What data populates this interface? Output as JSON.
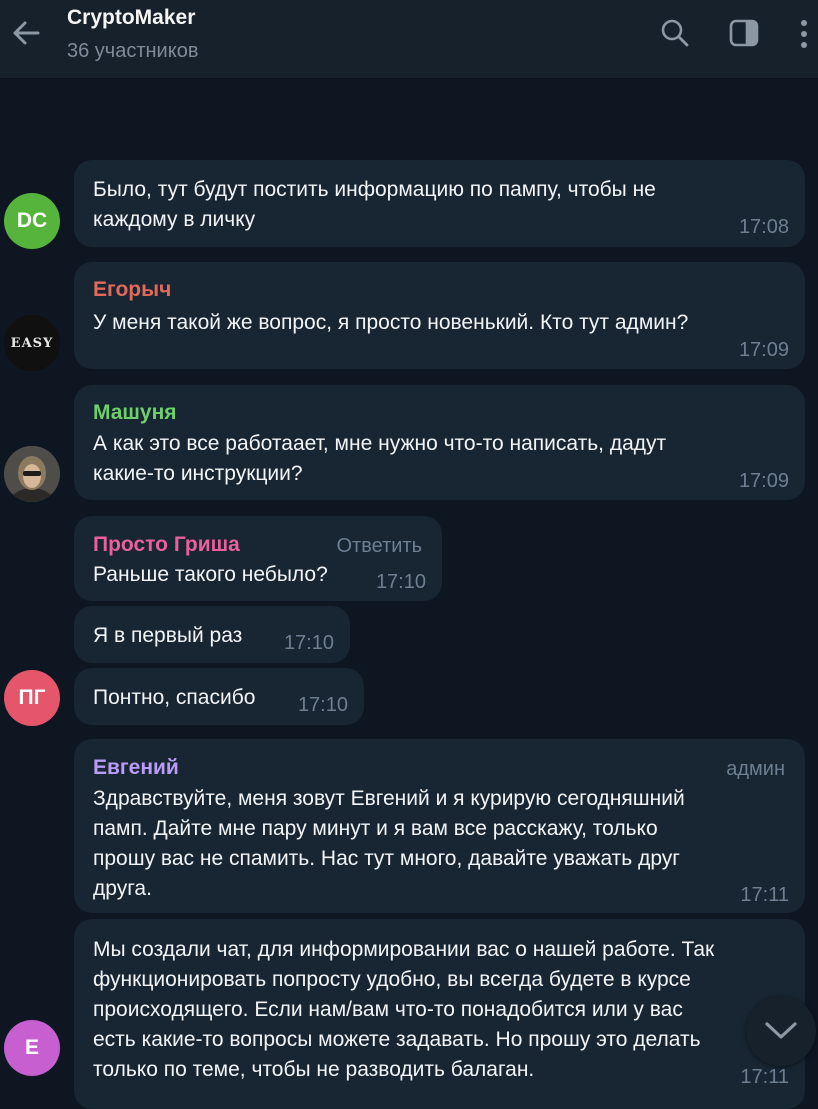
{
  "header": {
    "title": "CryptoMaker",
    "subtitle": "36 участников"
  },
  "messages": [
    {
      "author": "",
      "lines": [
        "Было, тут будут постить информацию по пампу, чтобы не",
        "каждому в личку"
      ],
      "time": "17:08"
    },
    {
      "author": "Егорыч",
      "lines": [
        "У меня такой же вопрос, я просто новенький. Кто тут админ?"
      ],
      "time": "17:09"
    },
    {
      "author": "Машуня",
      "lines": [
        "А как это все работаает, мне нужно что-то написать, дадут",
        "какие-то инструкции?"
      ],
      "time": "17:09"
    },
    {
      "author": "Просто Гриша",
      "reply_label": "Ответить",
      "lines": [
        "Раньше такого небыло?"
      ],
      "time": "17:10"
    },
    {
      "author": "",
      "lines": [
        "Я в первый раз"
      ],
      "time": "17:10"
    },
    {
      "author": "",
      "lines": [
        "Понтно, спасибо"
      ],
      "time": "17:10"
    },
    {
      "author": "Евгений",
      "role": "админ",
      "lines": [
        "Здравствуйте, меня зовут Евгений и я курирую сегодняшний",
        "памп. Дайте мне пару минут и я вам все расскажу, только",
        "прошу вас не спамить. Нас тут много, давайте уважать друг",
        "друга."
      ],
      "time": "17:11"
    },
    {
      "author": "",
      "lines": [
        "Мы создали чат, для информировании вас о нашей работе. Так",
        "функционировать попросту удобно, вы всегда будете в курсе",
        "происходящего. Если нам/вам что-то понадобится или у вас",
        "есть какие-то вопросы можете задавать. Но прошу это делать",
        "только по теме, чтобы не разводить балаган."
      ],
      "time": "17:11"
    }
  ],
  "avatars": {
    "dc": {
      "initials": "DC",
      "color": "#56b33c"
    },
    "easy": {
      "text": "EASY",
      "color": "#101010"
    },
    "pg": {
      "initials": "ПГ",
      "color": "#e5566b"
    },
    "e": {
      "initials": "E",
      "color": "#c75fd1"
    }
  },
  "colors": {
    "egorych": "#e26a5a",
    "mashunya": "#6fcf6a",
    "grisha": "#ea5f9c",
    "evgeniy": "#b99cf7"
  }
}
